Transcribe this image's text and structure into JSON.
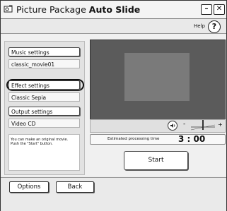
{
  "window": {
    "title_prefix": "Picture Package",
    "title_bold": "Auto Slide",
    "minimize_glyph": "–",
    "close_glyph": "✕"
  },
  "help": {
    "label": "Help",
    "button_glyph": "?"
  },
  "settings": {
    "music_button": "Music settings",
    "music_value": "classic_movie01",
    "effect_button": "Effect settings",
    "effect_value": "Classic Sepia",
    "output_button": "Output settings",
    "output_value": "Video CD"
  },
  "info": {
    "line1": "You can make an original movie.",
    "line2": "Push the \"Start\" button."
  },
  "controls": {
    "volume_minus": "-",
    "volume_plus": "+",
    "speaker_icon": "speaker-icon"
  },
  "estimate": {
    "label": "Estimated processing time",
    "value": "3 : 00"
  },
  "start_button": "Start",
  "bottom": {
    "options_button": "Options",
    "back_button": "Back"
  }
}
